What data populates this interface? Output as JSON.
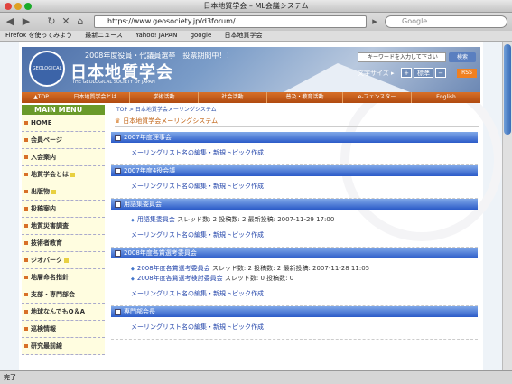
{
  "window": {
    "title": "日本地質学会 – ML会議システム"
  },
  "browser": {
    "url": "https://www.geosociety.jp/d3forum/",
    "search_placeholder": "Google",
    "bookmarks": [
      "Firefox を使ってみよう",
      "最新ニュース",
      "Yahoo! JAPAN",
      "google",
      "日本地質学会"
    ],
    "status": "完了"
  },
  "banner": {
    "subtitle": "2008年度役員・代議員選挙　投票期間中！！",
    "title": "日本地質学会",
    "title_en": "THE GEOLOGICAL SOCIETY OF JAPAN",
    "seal": "GEOLOGICAL SOCIETY",
    "search_placeholder": "キーワードを入力して下さい",
    "search_button": "検索",
    "font_size_label": "文字サイズ ▸",
    "font_plus": "+",
    "font_standard": "標準",
    "font_minus": "−",
    "rss": "RSS"
  },
  "nav": [
    "▲TOP",
    "日本地質学会とは",
    "学術活動",
    "社会活動",
    "普及・教育活動",
    "e-フェンスター",
    "English"
  ],
  "sidebar": {
    "header": "MAIN MENU",
    "items": [
      "HOME",
      "会員ページ",
      "入会案内",
      "地質学会とは",
      "出版物",
      "投稿案内",
      "地質災害調査",
      "技術者教育",
      "ジオパーク",
      "地層命名指針",
      "支部・専門部会",
      "地球なんでもQ＆A",
      "巡検情報",
      "研究最前線"
    ],
    "new_flags": [
      false,
      false,
      false,
      true,
      true,
      false,
      false,
      false,
      true,
      false,
      false,
      false,
      false,
      false
    ]
  },
  "main": {
    "breadcrumb": "TOP > 日本地質学会メーリングシステム",
    "title": "日本地質学会メーリングシステム",
    "sections": [
      {
        "name": "2007年度理事会",
        "lists": [],
        "footer": "メーリングリスト名の編集・新規トピック作成"
      },
      {
        "name": "2007年度4役会議",
        "lists": [],
        "footer": "メーリングリスト名の編集・新規トピック作成"
      },
      {
        "name": "用語集委員会",
        "lists": [
          {
            "name": "用語集委員会",
            "meta": "スレッド数: 2 投稿数: 2 最新投稿: 2007-11-29 17:00"
          }
        ],
        "footer": "メーリングリスト名の編集・新規トピック作成"
      },
      {
        "name": "2008年度各賞選考委員会",
        "lists": [
          {
            "name": "2008年度各賞選考委員会",
            "meta": "スレッド数: 2 投稿数: 2 最新投稿: 2007-11-28 11:05"
          },
          {
            "name": "2008年度各賞選考検討委員会",
            "meta": "スレッド数: 0 投稿数: 0"
          }
        ],
        "footer": "メーリングリスト名の編集・新規トピック作成"
      },
      {
        "name": "専門部会長",
        "lists": [],
        "footer": "メーリングリスト名の編集・新規トピック作成"
      }
    ]
  }
}
